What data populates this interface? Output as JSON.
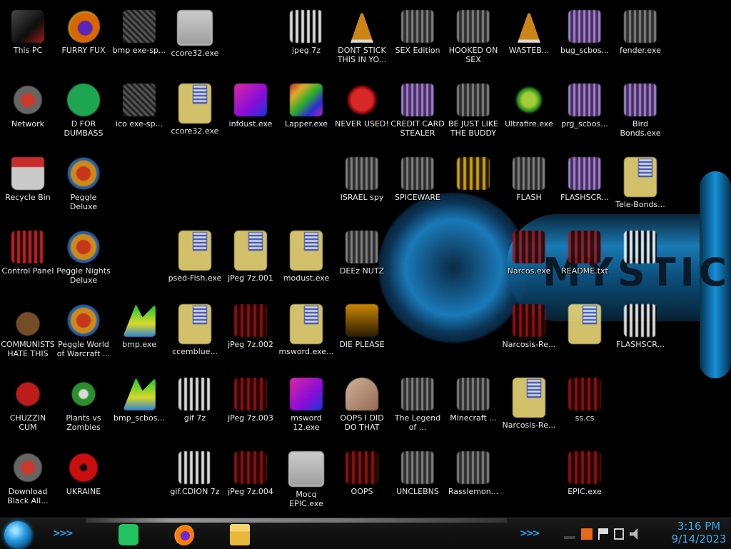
{
  "desktop": {
    "icons": [
      {
        "label": "This PC",
        "art": "t-pc"
      },
      {
        "label": "FURRY FUX",
        "art": "t-ff"
      },
      {
        "label": "bmp exe-sp...",
        "art": "t-bmp"
      },
      {
        "label": "ccore32.exe",
        "art": "t-face"
      },
      {
        "label": "jpeg 7z",
        "art": "t-7z"
      },
      {
        "label": "DONT STICK THIS IN YO...",
        "art": "t-cone"
      },
      {
        "label": "SEX Edition",
        "art": "t-gray"
      },
      {
        "label": "HOOKED ON SEX",
        "art": "t-gray"
      },
      {
        "label": "WASTEB...",
        "art": "t-cone"
      },
      {
        "label": "bug_scbos...",
        "art": "t-purple"
      },
      {
        "label": "fender.exe",
        "art": "t-gray"
      },
      {
        "label": "Network",
        "art": "t-net"
      },
      {
        "label": "D FOR DUMBASS",
        "art": "t-green"
      },
      {
        "label": "ico exe-sp...",
        "art": "t-bmp"
      },
      {
        "label": "ccore32.exe",
        "art": "t-note"
      },
      {
        "label": "infdust.exe",
        "art": "t-pink"
      },
      {
        "label": "Lapper.exe",
        "art": "t-rainbow"
      },
      {
        "label": "NEVER USED!",
        "art": "t-red"
      },
      {
        "label": "CREDIT CARD STEALER",
        "art": "t-purple"
      },
      {
        "label": "BE JUST LIKE THE BUDDY",
        "art": "t-gray"
      },
      {
        "label": "Ultrafire.exe",
        "art": "t-limegreen"
      },
      {
        "label": "prg_scbos...",
        "art": "t-purple"
      },
      {
        "label": "Bird Bonds.exe",
        "art": "t-purple"
      },
      {
        "label": "Recycle Bin",
        "art": "t-bin"
      },
      {
        "label": "Peggle Deluxe",
        "art": "t-peggle"
      },
      {
        "label": "ISRAEL spy",
        "art": "t-gray"
      },
      {
        "label": "SPICEWARE",
        "art": "t-gray"
      },
      {
        "label": "",
        "art": "t-yellowish"
      },
      {
        "label": "FLASH",
        "art": "t-gray"
      },
      {
        "label": "FLASHSCR...",
        "art": "t-purple"
      },
      {
        "label": "Tele-Bonds...",
        "art": "t-note"
      },
      {
        "label": "Control Panel",
        "art": "t-cp"
      },
      {
        "label": "Peggle Nights Deluxe",
        "art": "t-peggle"
      },
      {
        "label": "psed-Fish.exe",
        "art": "t-note"
      },
      {
        "label": "jPeg 7z.001",
        "art": "t-note"
      },
      {
        "label": "modust.exe",
        "art": "t-note"
      },
      {
        "label": "DEEz NUTZ",
        "art": "t-gray"
      },
      {
        "label": "Narcos.exe",
        "art": "t-darkred"
      },
      {
        "label": "README.txt",
        "art": "t-darkred"
      },
      {
        "label": "",
        "art": "t-7z"
      },
      {
        "label": "COMMUNISTS HATE THIS G...",
        "art": "t-bag"
      },
      {
        "label": "Peggle World of Warcraft ...",
        "art": "t-peggle"
      },
      {
        "label": "bmp.exe",
        "art": "t-fire"
      },
      {
        "label": "ccemblue...",
        "art": "t-note"
      },
      {
        "label": "jPeg 7z.002",
        "art": "t-darkred"
      },
      {
        "label": "msword.exe...",
        "art": "t-note"
      },
      {
        "label": "DIE PLEASE",
        "art": "t-orange"
      },
      {
        "label": "Narcosis-Re...",
        "art": "t-darkred"
      },
      {
        "label": "",
        "art": "t-note"
      },
      {
        "label": "FLASHSCR...",
        "art": "t-7z"
      },
      {
        "label": "CHUZZIN CUM",
        "art": "t-chuz"
      },
      {
        "label": "Plants vs Zombies",
        "art": "t-flower"
      },
      {
        "label": "bmp_scbos...",
        "art": "t-fire"
      },
      {
        "label": "gif 7z",
        "art": "t-7z"
      },
      {
        "label": "jPeg 7z.003",
        "art": "t-darkred"
      },
      {
        "label": "msword 12.exe",
        "art": "t-pink"
      },
      {
        "label": "OOPS I DID DO THAT",
        "art": "t-skin"
      },
      {
        "label": "The Legend of ...",
        "art": "t-gray"
      },
      {
        "label": "Minecraft ...",
        "art": "t-gray"
      },
      {
        "label": "Narcosis-Re...",
        "art": "t-note"
      },
      {
        "label": "ss.cs",
        "art": "t-darkred"
      },
      {
        "label": "Download Black All...",
        "art": "t-net"
      },
      {
        "label": "UKRAINE",
        "art": "t-nuke"
      },
      {
        "label": "gif.CDION 7z",
        "art": "t-7z"
      },
      {
        "label": "jPeg 7z.004",
        "art": "t-darkred"
      },
      {
        "label": "Mocq EPIC.exe",
        "art": "t-face"
      },
      {
        "label": "OOPS",
        "art": "t-darkred"
      },
      {
        "label": "UNCLEBNS",
        "art": "t-gray"
      },
      {
        "label": "Rasslemon...",
        "art": "t-gray"
      },
      {
        "label": "EPIC.exe",
        "art": "t-darkred"
      }
    ]
  },
  "wallpaper": {
    "text": "MYSTIC"
  },
  "taskbar": {
    "start_label": "Start",
    "chevrons": ">>>",
    "apps": [
      {
        "name": "spotify-icon"
      },
      {
        "name": "firefox-icon"
      },
      {
        "name": "file-explorer-icon"
      }
    ],
    "clock_time": "3:16 PM",
    "clock_date": "9/14/2023"
  },
  "colors": {
    "accent": "#27a6f0",
    "taskbar": "#111111"
  }
}
